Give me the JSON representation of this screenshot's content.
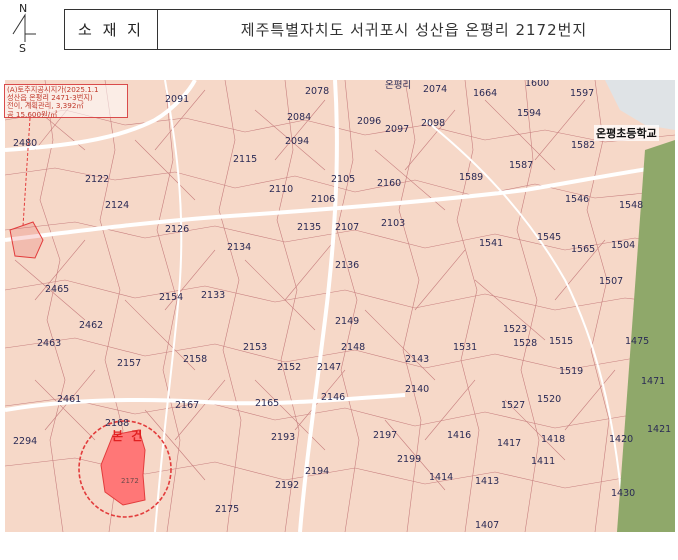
{
  "header": {
    "north_letter": "N",
    "south_letter": "S",
    "location_label": "소 재 지",
    "address": "제주특별자치도 서귀포시 성산읍 온평리 2172번지"
  },
  "map": {
    "info_lines": [
      "(A)토추지공시지가(2025.1.1",
      "성산읍 온평리 2471-3번지)",
      "전이, 계획관리, 3,392㎡",
      "공 15,600원/㎡"
    ],
    "school_label": "온평초등학교",
    "subject_label": "본 건",
    "village_label": "온평리",
    "accent_color": "#e23c3c",
    "road_color": "#ffffff",
    "green_strip_color": "#8fa86a",
    "parcel_numbers": [
      "2091",
      "2078",
      "2074",
      "1664",
      "1600",
      "1597",
      "2084",
      "2096",
      "2097",
      "2098",
      "1594",
      "2480",
      "2115",
      "2094",
      "1587",
      "1582",
      "2122",
      "2105",
      "2160",
      "1589",
      "2110",
      "2106",
      "1546",
      "1548",
      "2124",
      "2135",
      "2107",
      "2103",
      "1541",
      "1545",
      "1565",
      "1504",
      "2126",
      "2134",
      "2136",
      "2465",
      "2154",
      "2133",
      "1507",
      "2462",
      "2149",
      "1523",
      "2463",
      "2148",
      "1528",
      "1515",
      "1475",
      "2153",
      "2143",
      "1531",
      "2158",
      "2157",
      "2152",
      "2147",
      "1519",
      "1471",
      "2461",
      "2167",
      "2165",
      "2146",
      "2140",
      "1527",
      "1520",
      "2168",
      "2193",
      "2197",
      "1416",
      "1418",
      "1417",
      "1420",
      "2294",
      "1421",
      "2172",
      "2199",
      "1411",
      "2194",
      "1414",
      "1413",
      "1430",
      "2192",
      "1407",
      "2175"
    ]
  }
}
